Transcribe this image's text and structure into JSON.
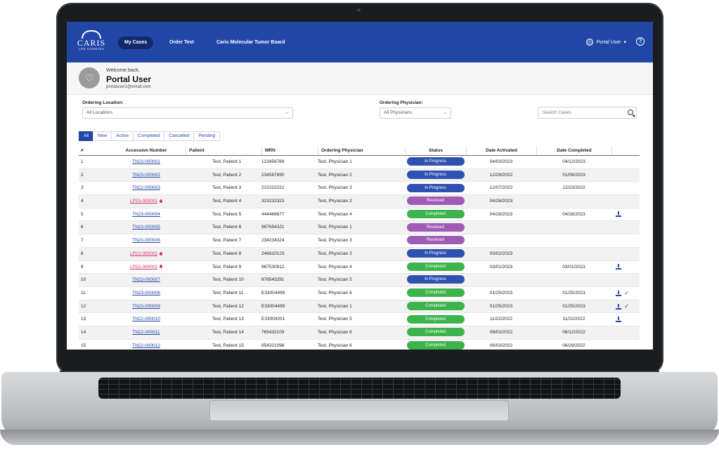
{
  "header": {
    "logo_word": "CARIS",
    "logo_sub": "LIFE SCIENCES",
    "nav": [
      {
        "label": "My Cases",
        "active": true
      },
      {
        "label": "Order Test",
        "active": false
      },
      {
        "label": "Caris Molecular Tumor Board",
        "active": false
      }
    ],
    "user_label": "Portal User",
    "help_glyph": "?"
  },
  "welcome": {
    "greeting": "Welcome back,",
    "name": "Portal User",
    "email": "portaluser1@email.com"
  },
  "filters": {
    "location_label": "Ordering Location:",
    "location_value": "All Locations",
    "physician_label": "Ordering Physician:",
    "physician_value": "All Physicians",
    "search_placeholder": "Search Cases"
  },
  "tabs": [
    "All",
    "New",
    "Active",
    "Completed",
    "Cancelled",
    "Pending"
  ],
  "columns": [
    "#",
    "Accession Number",
    "Patient",
    "MRN",
    "Ordering Physician",
    "Status",
    "Date Activated",
    "Date Completed"
  ],
  "status_colors": {
    "In Progress": "#2f52b0",
    "Received": "#a05cb4",
    "Completed": "#3cb44b"
  },
  "rows": [
    {
      "num": "1",
      "acc": "TN23-000001",
      "lp": false,
      "patient": "Test, Patient 1",
      "mrn": "123456789",
      "physician": "Test, Physician 1",
      "status": "In Progress",
      "activated": "04/03/2023",
      "completed": "04/12/2023",
      "download": false,
      "check": false
    },
    {
      "num": "2",
      "acc": "TN23-000002",
      "lp": false,
      "patient": "Test, Patient 2",
      "mrn": "234567890",
      "physician": "Test, Physician 2",
      "status": "In Progress",
      "activated": "12/29/2022",
      "completed": "01/09/2023",
      "download": false,
      "check": false
    },
    {
      "num": "3",
      "acc": "TN22-000003",
      "lp": false,
      "patient": "Test, Patient 3",
      "mrn": "222222222",
      "physician": "Test, Physician 3",
      "status": "In Progress",
      "activated": "12/07/2022",
      "completed": "12/23/2022",
      "download": false,
      "check": false
    },
    {
      "num": "4",
      "acc": "LP23-000001",
      "lp": true,
      "patient": "Test, Patient 4",
      "mrn": "323232323",
      "physician": "Test, Physician 2",
      "status": "Received",
      "activated": "04/26/2023",
      "completed": "",
      "download": false,
      "check": false
    },
    {
      "num": "5",
      "acc": "TN23-000004",
      "lp": false,
      "patient": "Test, Patient 5",
      "mrn": "444466677",
      "physician": "Test, Physician 4",
      "status": "Completed",
      "activated": "04/28/2023",
      "completed": "04/28/2023",
      "download": true,
      "check": false
    },
    {
      "num": "6",
      "acc": "TN23-000005",
      "lp": false,
      "patient": "Test, Patient 6",
      "mrn": "987654321",
      "physician": "Test, Physician 1",
      "status": "Received",
      "activated": "",
      "completed": "",
      "download": false,
      "check": false
    },
    {
      "num": "7",
      "acc": "TN23-000006",
      "lp": false,
      "patient": "Test, Patient 7",
      "mrn": "234234324",
      "physician": "Test, Physician 3",
      "status": "Received",
      "activated": "",
      "completed": "",
      "download": false,
      "check": false
    },
    {
      "num": "8",
      "acc": "LP23-000002",
      "lp": true,
      "patient": "Test, Patient 8",
      "mrn": "246810123",
      "physician": "Test, Physician 2",
      "status": "In Progress",
      "activated": "03/02/2023",
      "completed": "",
      "download": false,
      "check": false
    },
    {
      "num": "9",
      "acc": "LP23-000003",
      "lp": true,
      "patient": "Test, Patient 9",
      "mrn": "867530912",
      "physician": "Test, Physician 4",
      "status": "Completed",
      "activated": "03/01/2023",
      "completed": "03/01/2023",
      "download": true,
      "check": false
    },
    {
      "num": "10",
      "acc": "TN23-000007",
      "lp": false,
      "patient": "Test, Patient 10",
      "mrn": "876543291",
      "physician": "Test, Physician 5",
      "status": "In Progress",
      "activated": "",
      "completed": "",
      "download": false,
      "check": false
    },
    {
      "num": "11",
      "acc": "TN23-000008",
      "lp": false,
      "patient": "Test, Patient 11",
      "mrn": "E33004499",
      "physician": "Test, Physician 6",
      "status": "Completed",
      "activated": "01/25/2023",
      "completed": "01/25/2023",
      "download": true,
      "check": true
    },
    {
      "num": "12",
      "acc": "TN23-000009",
      "lp": false,
      "patient": "Test, Patient 12",
      "mrn": "E33004499",
      "physician": "Test, Physician 1",
      "status": "Completed",
      "activated": "01/25/2023",
      "completed": "01/25/2023",
      "download": true,
      "check": true
    },
    {
      "num": "13",
      "acc": "TN22-000010",
      "lp": false,
      "patient": "Test, Patient 13",
      "mrn": "E33004201",
      "physician": "Test, Physician 5",
      "status": "Completed",
      "activated": "11/22/2022",
      "completed": "11/22/2022",
      "download": true,
      "check": false
    },
    {
      "num": "14",
      "acc": "TN22-000011",
      "lp": false,
      "patient": "Test, Patient 14",
      "mrn": "765432109",
      "physician": "Test, Physician 6",
      "status": "Completed",
      "activated": "08/03/2022",
      "completed": "08/12/2022",
      "download": false,
      "check": false
    },
    {
      "num": "15",
      "acc": "TN22-000012",
      "lp": false,
      "patient": "Test, Patient 15",
      "mrn": "654321098",
      "physician": "Test, Physician 6",
      "status": "Completed",
      "activated": "06/03/2022",
      "completed": "06/29/2022",
      "download": false,
      "check": false
    }
  ]
}
